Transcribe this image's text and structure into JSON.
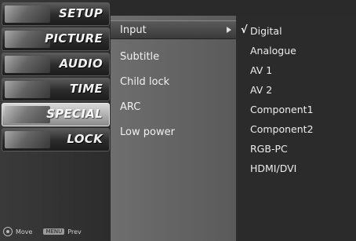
{
  "categories": [
    {
      "label": "SETUP",
      "active": false
    },
    {
      "label": "PICTURE",
      "active": false
    },
    {
      "label": "AUDIO",
      "active": false
    },
    {
      "label": "TIME",
      "active": false
    },
    {
      "label": "SPECIAL",
      "active": true
    },
    {
      "label": "LOCK",
      "active": false
    }
  ],
  "footer": {
    "move_label": "Move",
    "menu_key_label": "MENU",
    "prev_label": "Prev"
  },
  "menu": {
    "items": [
      {
        "label": "Input",
        "selected": true
      },
      {
        "label": "Subtitle",
        "selected": false
      },
      {
        "label": "Child lock",
        "selected": false
      },
      {
        "label": "ARC",
        "selected": false
      },
      {
        "label": "Low power",
        "selected": false
      }
    ]
  },
  "submenu": {
    "check_mark": "√",
    "items": [
      {
        "label": "Digital",
        "checked": true
      },
      {
        "label": "Analogue",
        "checked": false
      },
      {
        "label": "AV 1",
        "checked": false
      },
      {
        "label": "AV 2",
        "checked": false
      },
      {
        "label": "Component1",
        "checked": false
      },
      {
        "label": "Component2",
        "checked": false
      },
      {
        "label": "RGB-PC",
        "checked": false
      },
      {
        "label": "HDMI/DVI",
        "checked": false
      }
    ]
  }
}
